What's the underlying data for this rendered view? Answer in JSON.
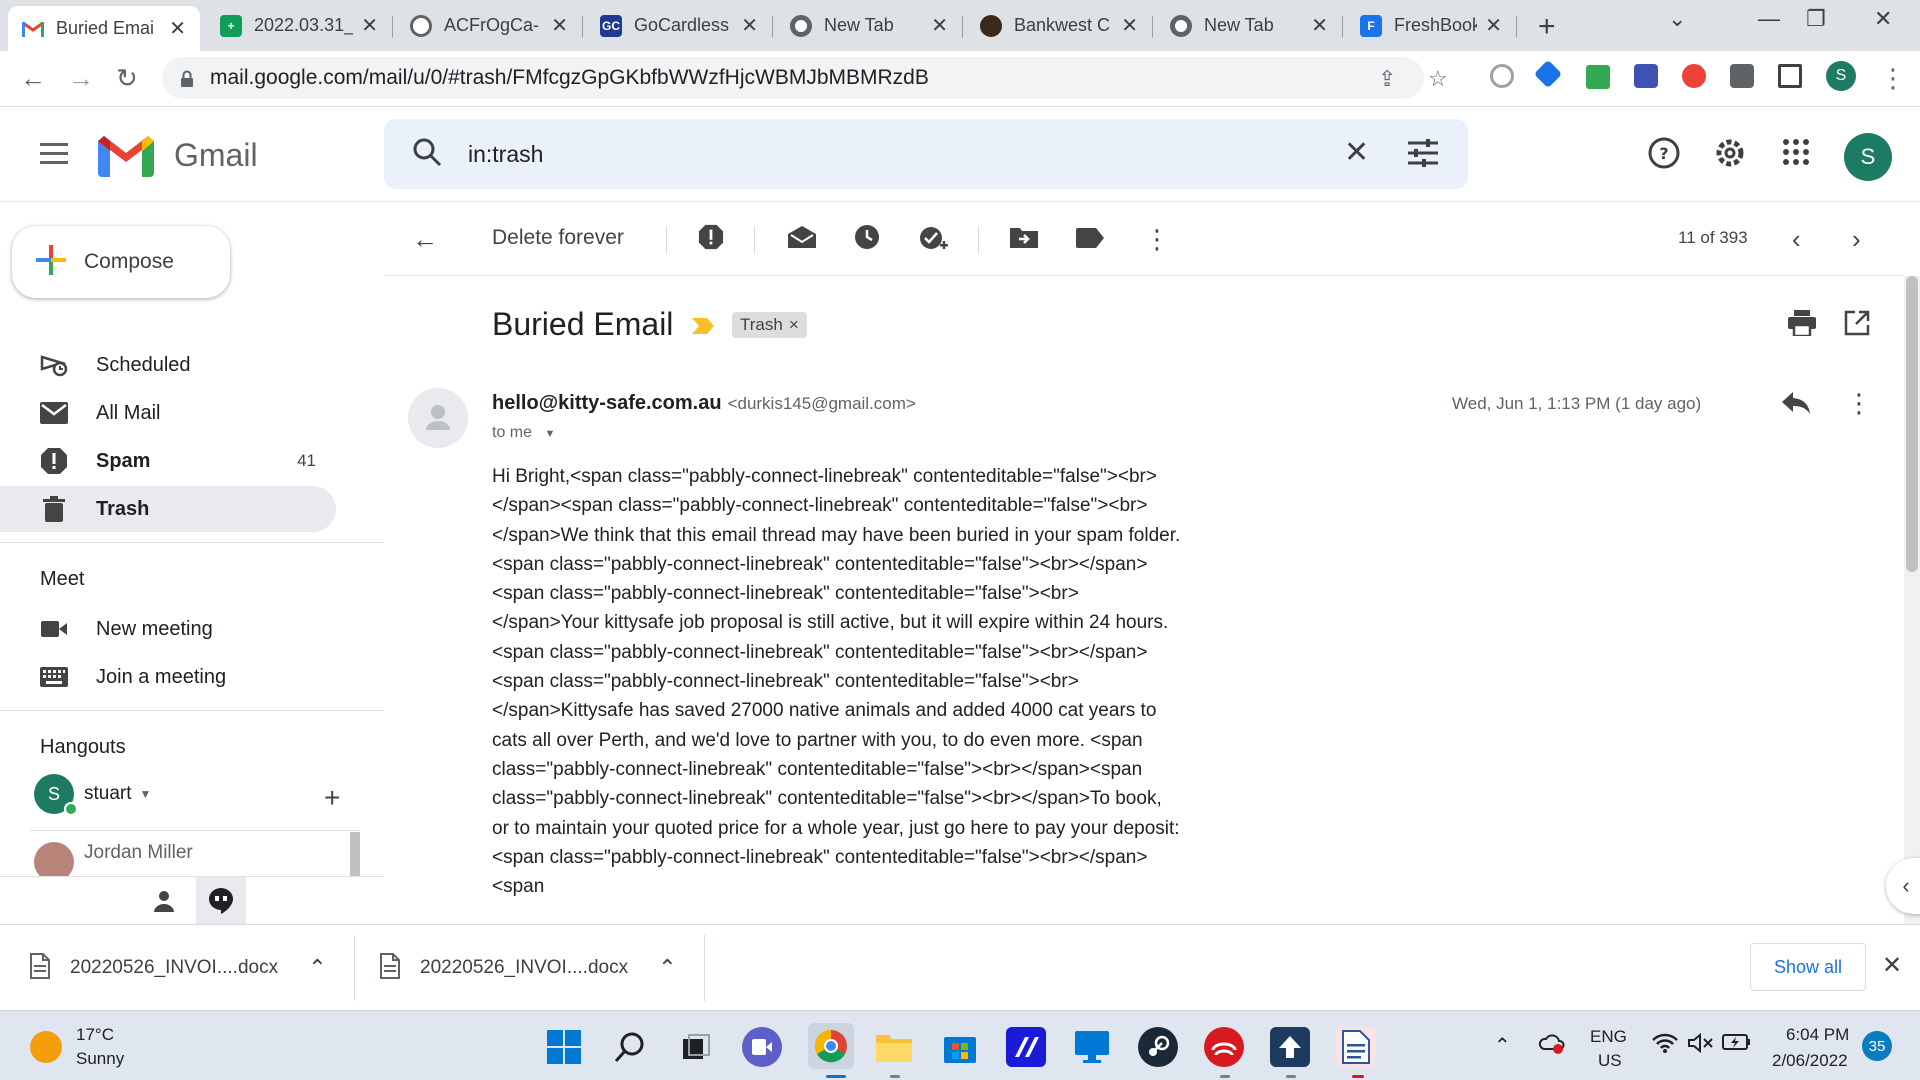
{
  "browser": {
    "tabs": [
      {
        "title": "Buried Emai",
        "favicon_color": "#ea4335",
        "favicon_text": "M",
        "active": true
      },
      {
        "title": "2022.03.31_",
        "favicon_color": "#0f9d58",
        "favicon_text": "+",
        "active": false
      },
      {
        "title": "ACFrOgCa-",
        "favicon_color": "#5f6368",
        "favicon_text": "",
        "active": false
      },
      {
        "title": "GoCardless",
        "favicon_color": "#1f3a93",
        "favicon_text": "GC",
        "active": false
      },
      {
        "title": "New Tab",
        "favicon_color": "#5f6368",
        "favicon_text": "",
        "active": false
      },
      {
        "title": "Bankwest C",
        "favicon_color": "#3a2a1a",
        "favicon_text": "",
        "active": false
      },
      {
        "title": "New Tab",
        "favicon_color": "#5f6368",
        "favicon_text": "",
        "active": false
      },
      {
        "title": "FreshBooks",
        "favicon_color": "#1a73e8",
        "favicon_text": "F",
        "active": false
      }
    ],
    "close_glyph": "✕",
    "new_tab_glyph": "+",
    "url": "mail.google.com/mail/u/0/#trash/FMfcgzGpGKbfbWWzfHjcWBMJbMBMRzdB",
    "profile_initial": "S"
  },
  "gmail": {
    "wordmark": "Gmail",
    "search_query": "in:trash",
    "account_initial": "S",
    "compose_label": "Compose",
    "nav_items": [
      {
        "label": "Scheduled",
        "count": "",
        "bold": false,
        "icon": "scheduled-icon",
        "active": false
      },
      {
        "label": "All Mail",
        "count": "",
        "bold": false,
        "icon": "mail-icon",
        "active": false
      },
      {
        "label": "Spam",
        "count": "41",
        "bold": true,
        "icon": "spam-icon",
        "active": false
      },
      {
        "label": "Trash",
        "count": "",
        "bold": true,
        "icon": "trash-icon",
        "active": true
      }
    ],
    "meet": {
      "title": "Meet",
      "items": [
        {
          "label": "New meeting",
          "icon": "video-camera-icon"
        },
        {
          "label": "Join a meeting",
          "icon": "keyboard-icon"
        }
      ]
    },
    "hangouts": {
      "title": "Hangouts",
      "user_name": "stuart",
      "user_initial": "S",
      "contact": "Jordan Miller"
    },
    "toolbar": {
      "delete_forever": "Delete forever",
      "pager": "11 of 393"
    },
    "email": {
      "subject": "Buried Email",
      "label_chip": "Trash",
      "label_chip_remove": "×",
      "sender_name": "hello@kitty-safe.com.au",
      "sender_email": "<durkis145@gmail.com>",
      "to": "to me",
      "date": "Wed, Jun 1, 1:13 PM (1 day ago)",
      "body": "Hi Bright,<span class=\"pabbly-connect-linebreak\" contenteditable=\"false\"><br></span><span class=\"pabbly-connect-linebreak\" contenteditable=\"false\"><br></span>We think that this email thread may have been buried in your spam folder. <span class=\"pabbly-connect-linebreak\" contenteditable=\"false\"><br></span><span class=\"pabbly-connect-linebreak\" contenteditable=\"false\"><br></span>Your kittysafe job proposal is still active, but it will expire within 24 hours.<span class=\"pabbly-connect-linebreak\" contenteditable=\"false\"><br></span><span class=\"pabbly-connect-linebreak\" contenteditable=\"false\"><br></span>Kittysafe has saved 27000 native animals and added 4000 cat years to cats all over Perth, and we'd love to partner with you, to do even more. <span class=\"pabbly-connect-linebreak\" contenteditable=\"false\"><br></span><span class=\"pabbly-connect-linebreak\" contenteditable=\"false\"><br></span>To book, or to maintain your quoted price for a whole year, just go here to pay your deposit:<span class=\"pabbly-connect-linebreak\" contenteditable=\"false\"><br></span><span"
    }
  },
  "downloads": {
    "items": [
      {
        "name": "20220526_INVOI....docx"
      },
      {
        "name": "20220526_INVOI....docx"
      }
    ],
    "chevron": "⌃",
    "show_all": "Show all",
    "close": "✕"
  },
  "taskbar": {
    "temperature": "17°C",
    "weather": "Sunny",
    "lang1": "ENG",
    "lang2": "US",
    "time": "6:04 PM",
    "date": "2/06/2022",
    "notifications": "35"
  },
  "colors": {
    "gmail_red": "#ea4335",
    "gmail_blue": "#4285f4",
    "gmail_green": "#34a853",
    "gmail_yellow": "#fbbc04",
    "account_green": "#1e7b63"
  }
}
